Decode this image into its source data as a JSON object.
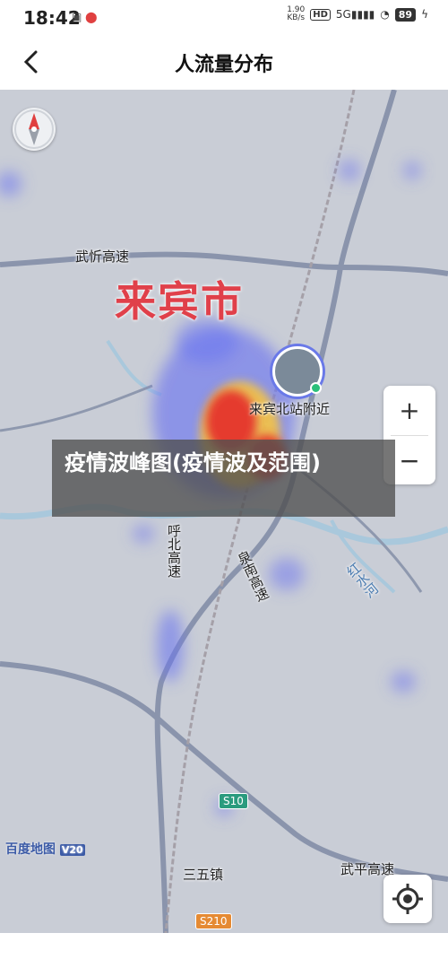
{
  "status_bar": {
    "time": "18:42",
    "icons": [
      "gallery-icon",
      "location-icon"
    ],
    "net_speed_value": "1.90",
    "net_speed_unit": "KB/s",
    "hd_badge": "HD",
    "signal": "5G",
    "battery": "89"
  },
  "header": {
    "back_icon": "chevron-left-icon",
    "title": "人流量分布"
  },
  "map": {
    "city_label": "来宾市",
    "road_labels": {
      "wuxin": "武忻高速",
      "hubei": "呼北高速",
      "quannan": "泉南高速",
      "wuping": "武平高速"
    },
    "river_label": "红水河",
    "town_label": "三五镇",
    "poi_label": "来宾北站附近",
    "shields": {
      "s10": "S10",
      "s210": "S210"
    },
    "provider_logo": "百度地图",
    "provider_version": "V20",
    "controls": {
      "zoom_in": "+",
      "zoom_out": "−"
    },
    "colors": {
      "heat_high": "#e53a2e",
      "heat_mid": "#f5c342",
      "heat_low": "#6b74f0",
      "city_label": "#e0404a"
    }
  },
  "overlay_caption": "疫情波峰图(疫情波及范围)"
}
